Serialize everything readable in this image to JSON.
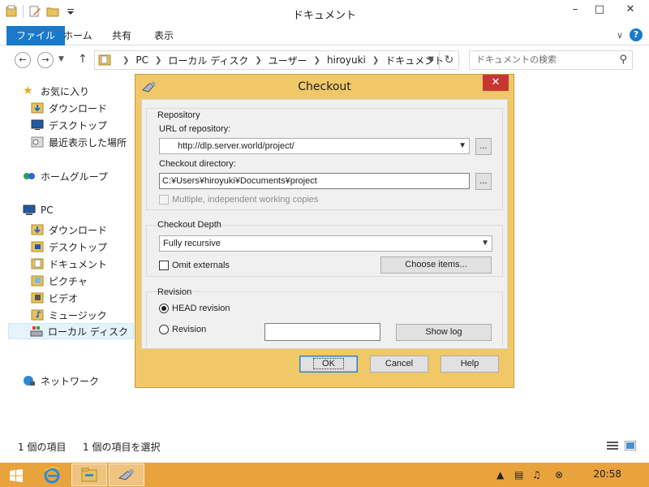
{
  "explorer": {
    "title": "ドキュメント",
    "ribbon_tabs": [
      "ファイル",
      "ホーム",
      "共有",
      "表示"
    ],
    "breadcrumb": [
      "PC",
      "ローカル ディスク",
      "ユーザー",
      "hiroyuki",
      "ドキュメント"
    ],
    "search_placeholder": "ドキュメントの検索",
    "nav": {
      "favorites": "お気に入り",
      "fav_items": [
        "ダウンロード",
        "デスクトップ",
        "最近表示した場所"
      ],
      "homegroup": "ホームグループ",
      "pc": "PC",
      "pc_items": [
        "ダウンロード",
        "デスクトップ",
        "ドキュメント",
        "ピクチャ",
        "ビデオ",
        "ミュージック",
        "ローカル ディスク"
      ],
      "network": "ネットワーク"
    },
    "status": {
      "items": "1 個の項目",
      "selected": "1 個の項目を選択"
    }
  },
  "taskbar": {
    "clock": "20:58"
  },
  "dialog": {
    "title": "Checkout",
    "repository": {
      "group_label": "Repository",
      "url_label": "URL of repository:",
      "url_value": "http://dlp.server.world/project/",
      "dir_label": "Checkout directory:",
      "dir_value": "C:¥Users¥hiroyuki¥Documents¥project",
      "browse_label": "...",
      "multiple_label": "Multiple, independent working copies"
    },
    "depth": {
      "group_label": "Checkout Depth",
      "value": "Fully recursive",
      "omit_label": "Omit externals",
      "choose_label": "Choose items..."
    },
    "revision": {
      "group_label": "Revision",
      "head_label": "HEAD revision",
      "rev_label": "Revision",
      "showlog_label": "Show log"
    },
    "buttons": {
      "ok": "OK",
      "cancel": "Cancel",
      "help": "Help"
    }
  },
  "colors": {
    "accent": "#1979ca",
    "dialog_frame": "#f0c868",
    "taskbar": "#e8a33d",
    "close": "#c7372f"
  }
}
